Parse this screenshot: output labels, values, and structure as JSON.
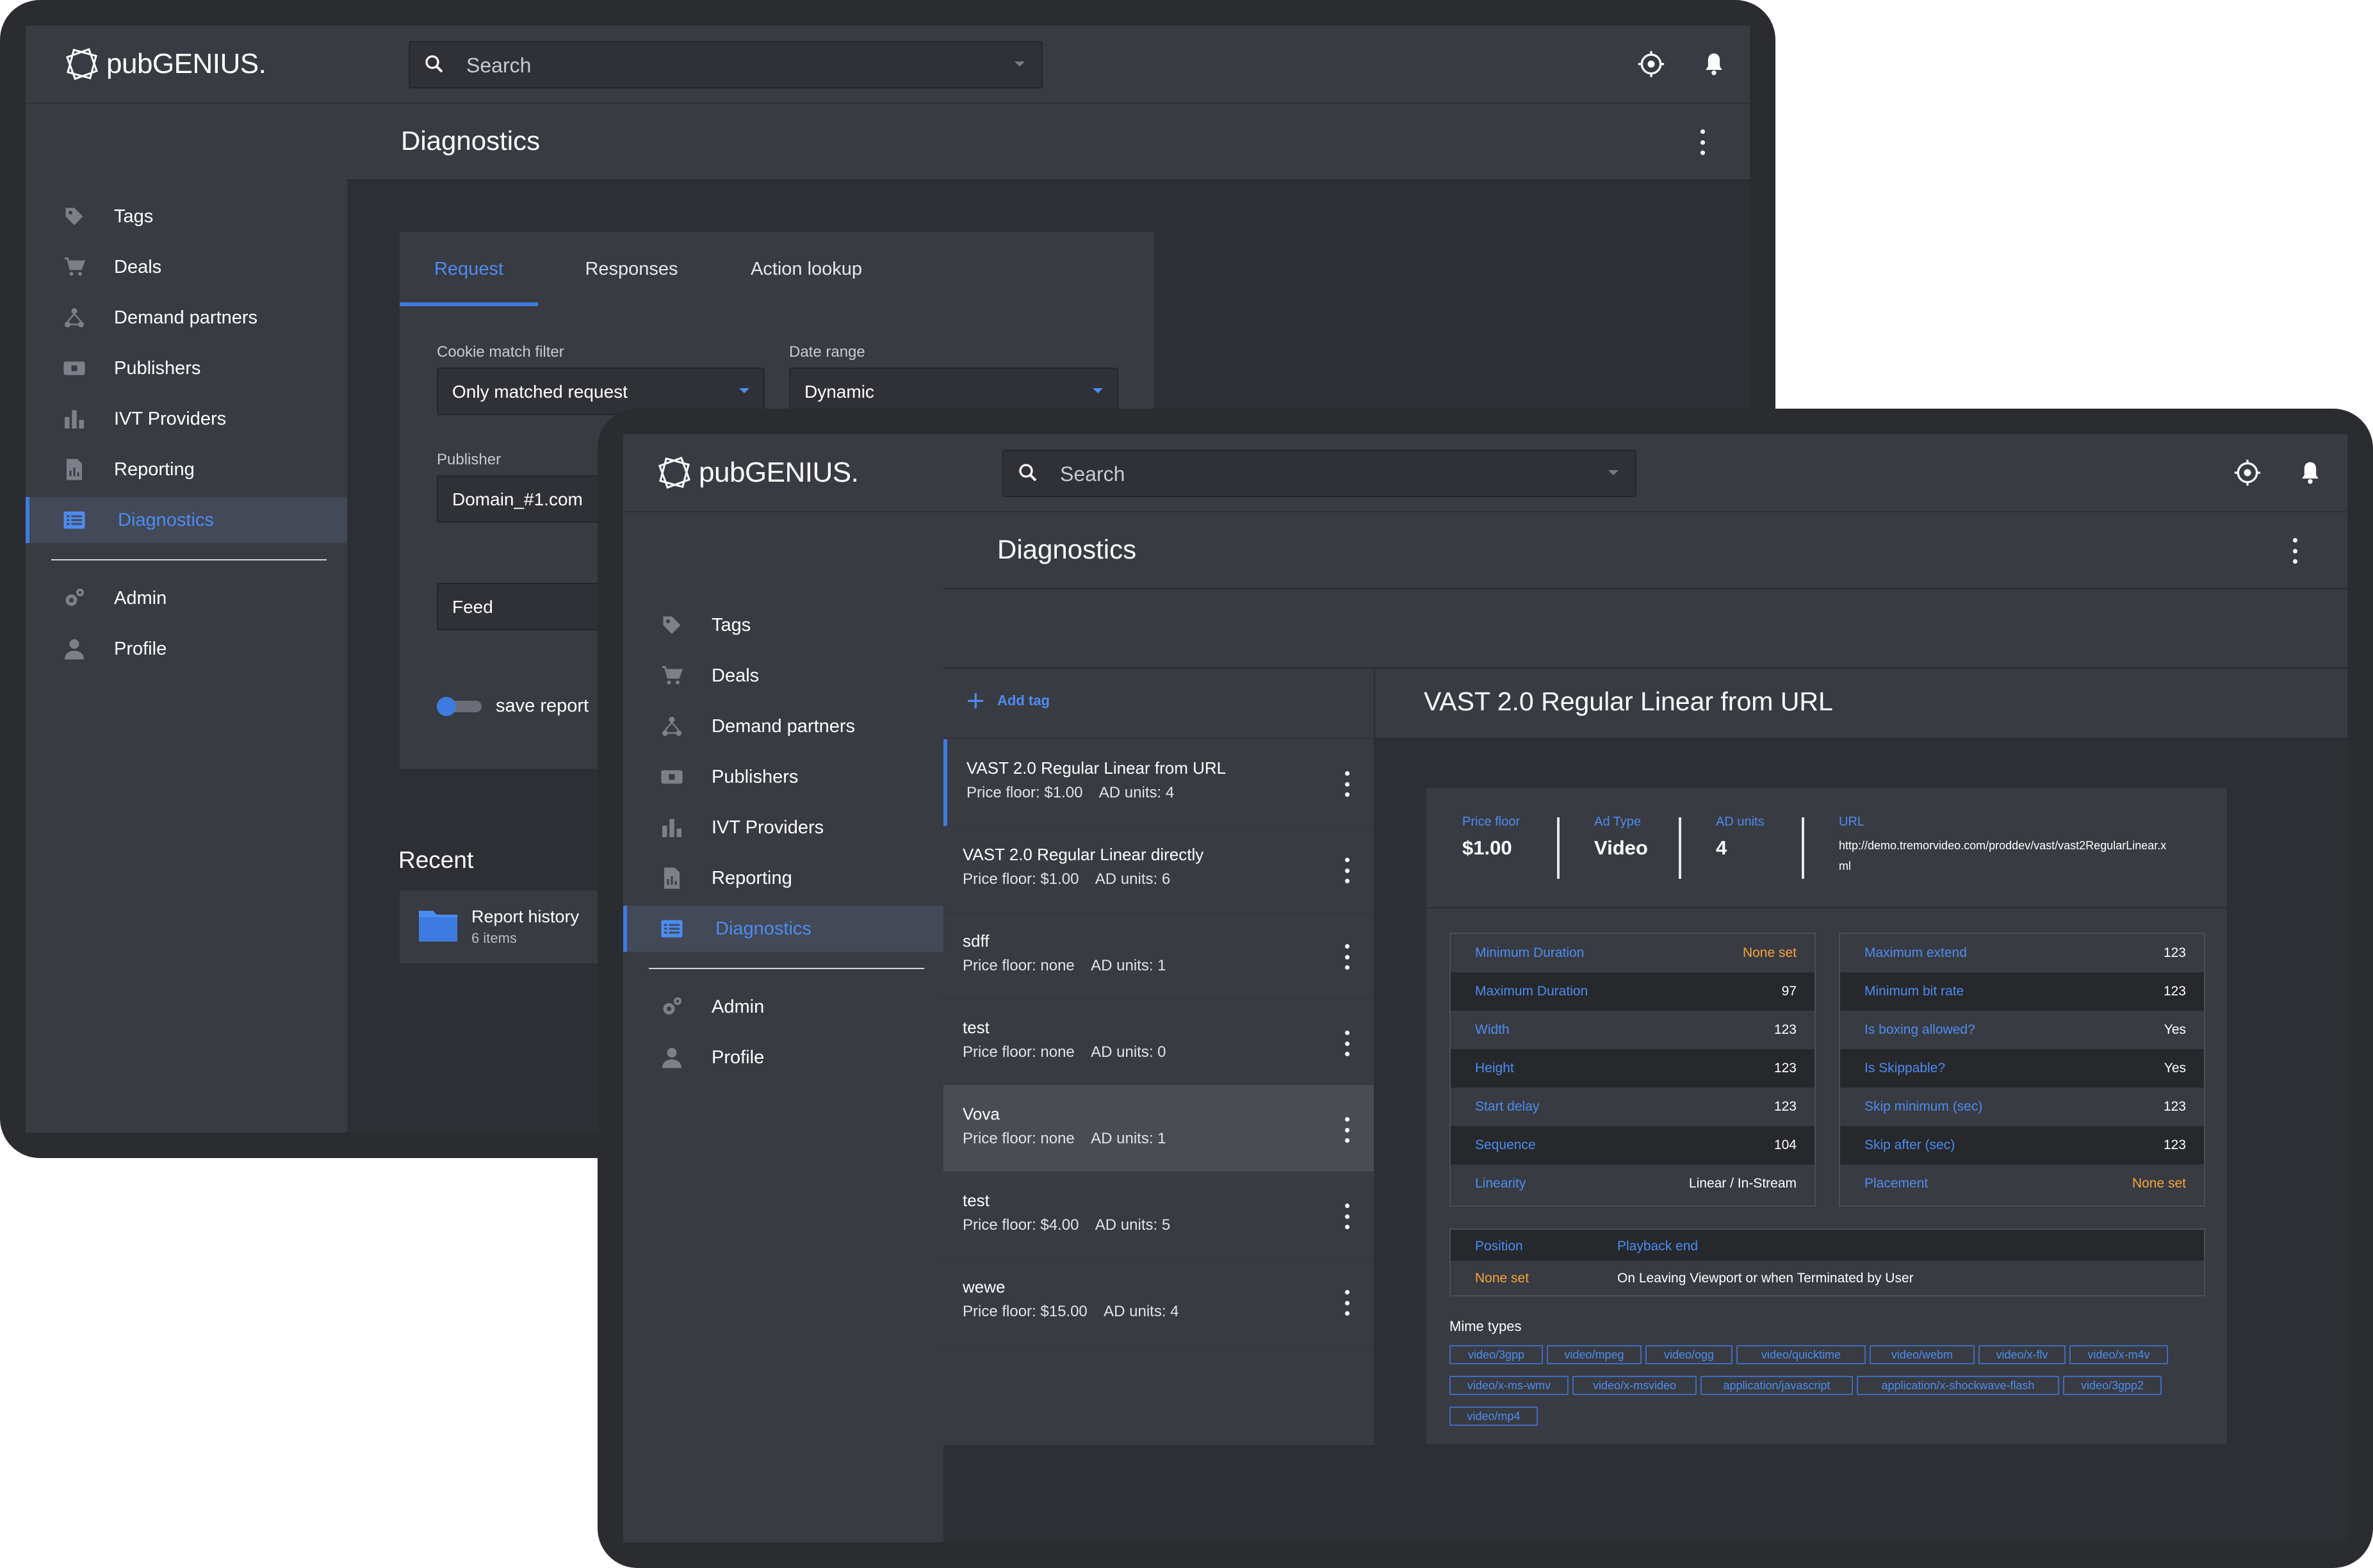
{
  "brand": {
    "name_light": "pub",
    "name_bold": "GENIUS."
  },
  "search": {
    "placeholder": "Search"
  },
  "nav": {
    "items": [
      {
        "label": "Tags",
        "icon": "tag-icon"
      },
      {
        "label": "Deals",
        "icon": "cart-icon"
      },
      {
        "label": "Demand partners",
        "icon": "network-icon"
      },
      {
        "label": "Publishers",
        "icon": "publisher-card-icon"
      },
      {
        "label": "IVT Providers",
        "icon": "bar-chart-icon"
      },
      {
        "label": "Reporting",
        "icon": "report-document-icon"
      },
      {
        "label": "Diagnostics",
        "icon": "list-view-icon",
        "active": true
      }
    ],
    "secondary": [
      {
        "label": "Admin",
        "icon": "gears-icon"
      },
      {
        "label": "Profile",
        "icon": "person-icon"
      }
    ]
  },
  "page": {
    "title": "Diagnostics"
  },
  "back": {
    "tabs": [
      "Request",
      "Responses",
      "Action lookup"
    ],
    "cookie_filter": {
      "label": "Cookie match filter",
      "value": "Only matched request"
    },
    "date_range": {
      "label": "Date range",
      "value": "Dynamic"
    },
    "publisher": {
      "label": "Publisher",
      "value": "Domain_#1.com"
    },
    "feed": {
      "value": "Feed"
    },
    "save_report": "save report",
    "recent": {
      "title": "Recent",
      "item_title": "Report history",
      "item_sub": "6 items"
    }
  },
  "front": {
    "add_tag": "Add tag",
    "tags": [
      {
        "title": "VAST 2.0 Regular Linear from URL",
        "price": "Price floor: $1.00",
        "units": "AD units: 4"
      },
      {
        "title": "VAST 2.0 Regular Linear directly",
        "price": "Price floor: $1.00",
        "units": "AD units: 6"
      },
      {
        "title": "sdff",
        "price": "Price floor: none",
        "units": "AD units: 1"
      },
      {
        "title": "test",
        "price": "Price floor: none",
        "units": "AD units: 0"
      },
      {
        "title": "Vova",
        "price": "Price floor: none",
        "units": "AD units: 1"
      },
      {
        "title": "test",
        "price": "Price floor: $4.00",
        "units": "AD units: 5"
      },
      {
        "title": "wewe",
        "price": "Price floor: $15.00",
        "units": "AD units: 4"
      }
    ],
    "detail": {
      "title": "VAST 2.0 Regular Linear from URL",
      "price_floor": {
        "label": "Price floor",
        "value": "$1.00"
      },
      "ad_type": {
        "label": "Ad Type",
        "value": "Video"
      },
      "ad_units": {
        "label": "AD units",
        "value": "4"
      },
      "url": {
        "label": "URL",
        "value_line1": "http://demo.tremorvideo.com/proddev/vast/vast2RegularLinear.x",
        "value_line2": "ml"
      },
      "left_table": [
        {
          "k": "Minimum Duration",
          "v": "None set",
          "warn": true
        },
        {
          "k": "Maximum Duration",
          "v": "97"
        },
        {
          "k": "Width",
          "v": "123"
        },
        {
          "k": "Height",
          "v": "123"
        },
        {
          "k": "Start delay",
          "v": "123"
        },
        {
          "k": "Sequence",
          "v": "104"
        },
        {
          "k": "Linearity",
          "v": "Linear / In-Stream"
        }
      ],
      "right_table": [
        {
          "k": "Maximum extend",
          "v": "123"
        },
        {
          "k": "Minimum bit rate",
          "v": "123"
        },
        {
          "k": "Is boxing allowed?",
          "v": "Yes"
        },
        {
          "k": "Is Skippable?",
          "v": "Yes"
        },
        {
          "k": "Skip minimum (sec)",
          "v": "123"
        },
        {
          "k": "Skip after (sec)",
          "v": "123"
        },
        {
          "k": "Placement",
          "v": "None set",
          "warn": true
        }
      ],
      "position": {
        "h1": "Position",
        "h2": "Playback end",
        "v1": "None set",
        "v2": "On Leaving Viewport or when Terminated by User"
      },
      "mime_title": "Mime types",
      "mime_types": [
        "video/3gpp",
        "video/mpeg",
        "video/ogg",
        "video/quicktime",
        "video/webm",
        "video/x-flv",
        "video/x-m4v",
        "video/x-ms-wmv",
        "video/x-msvideo",
        "application/javascript",
        "application/x-shockwave-flash",
        "video/3gpp2",
        "video/mp4"
      ]
    }
  },
  "colors": {
    "accent": "#3d7be0",
    "warning": "#f5a53b",
    "panel": "#393b42",
    "background": "#2d2f34"
  }
}
